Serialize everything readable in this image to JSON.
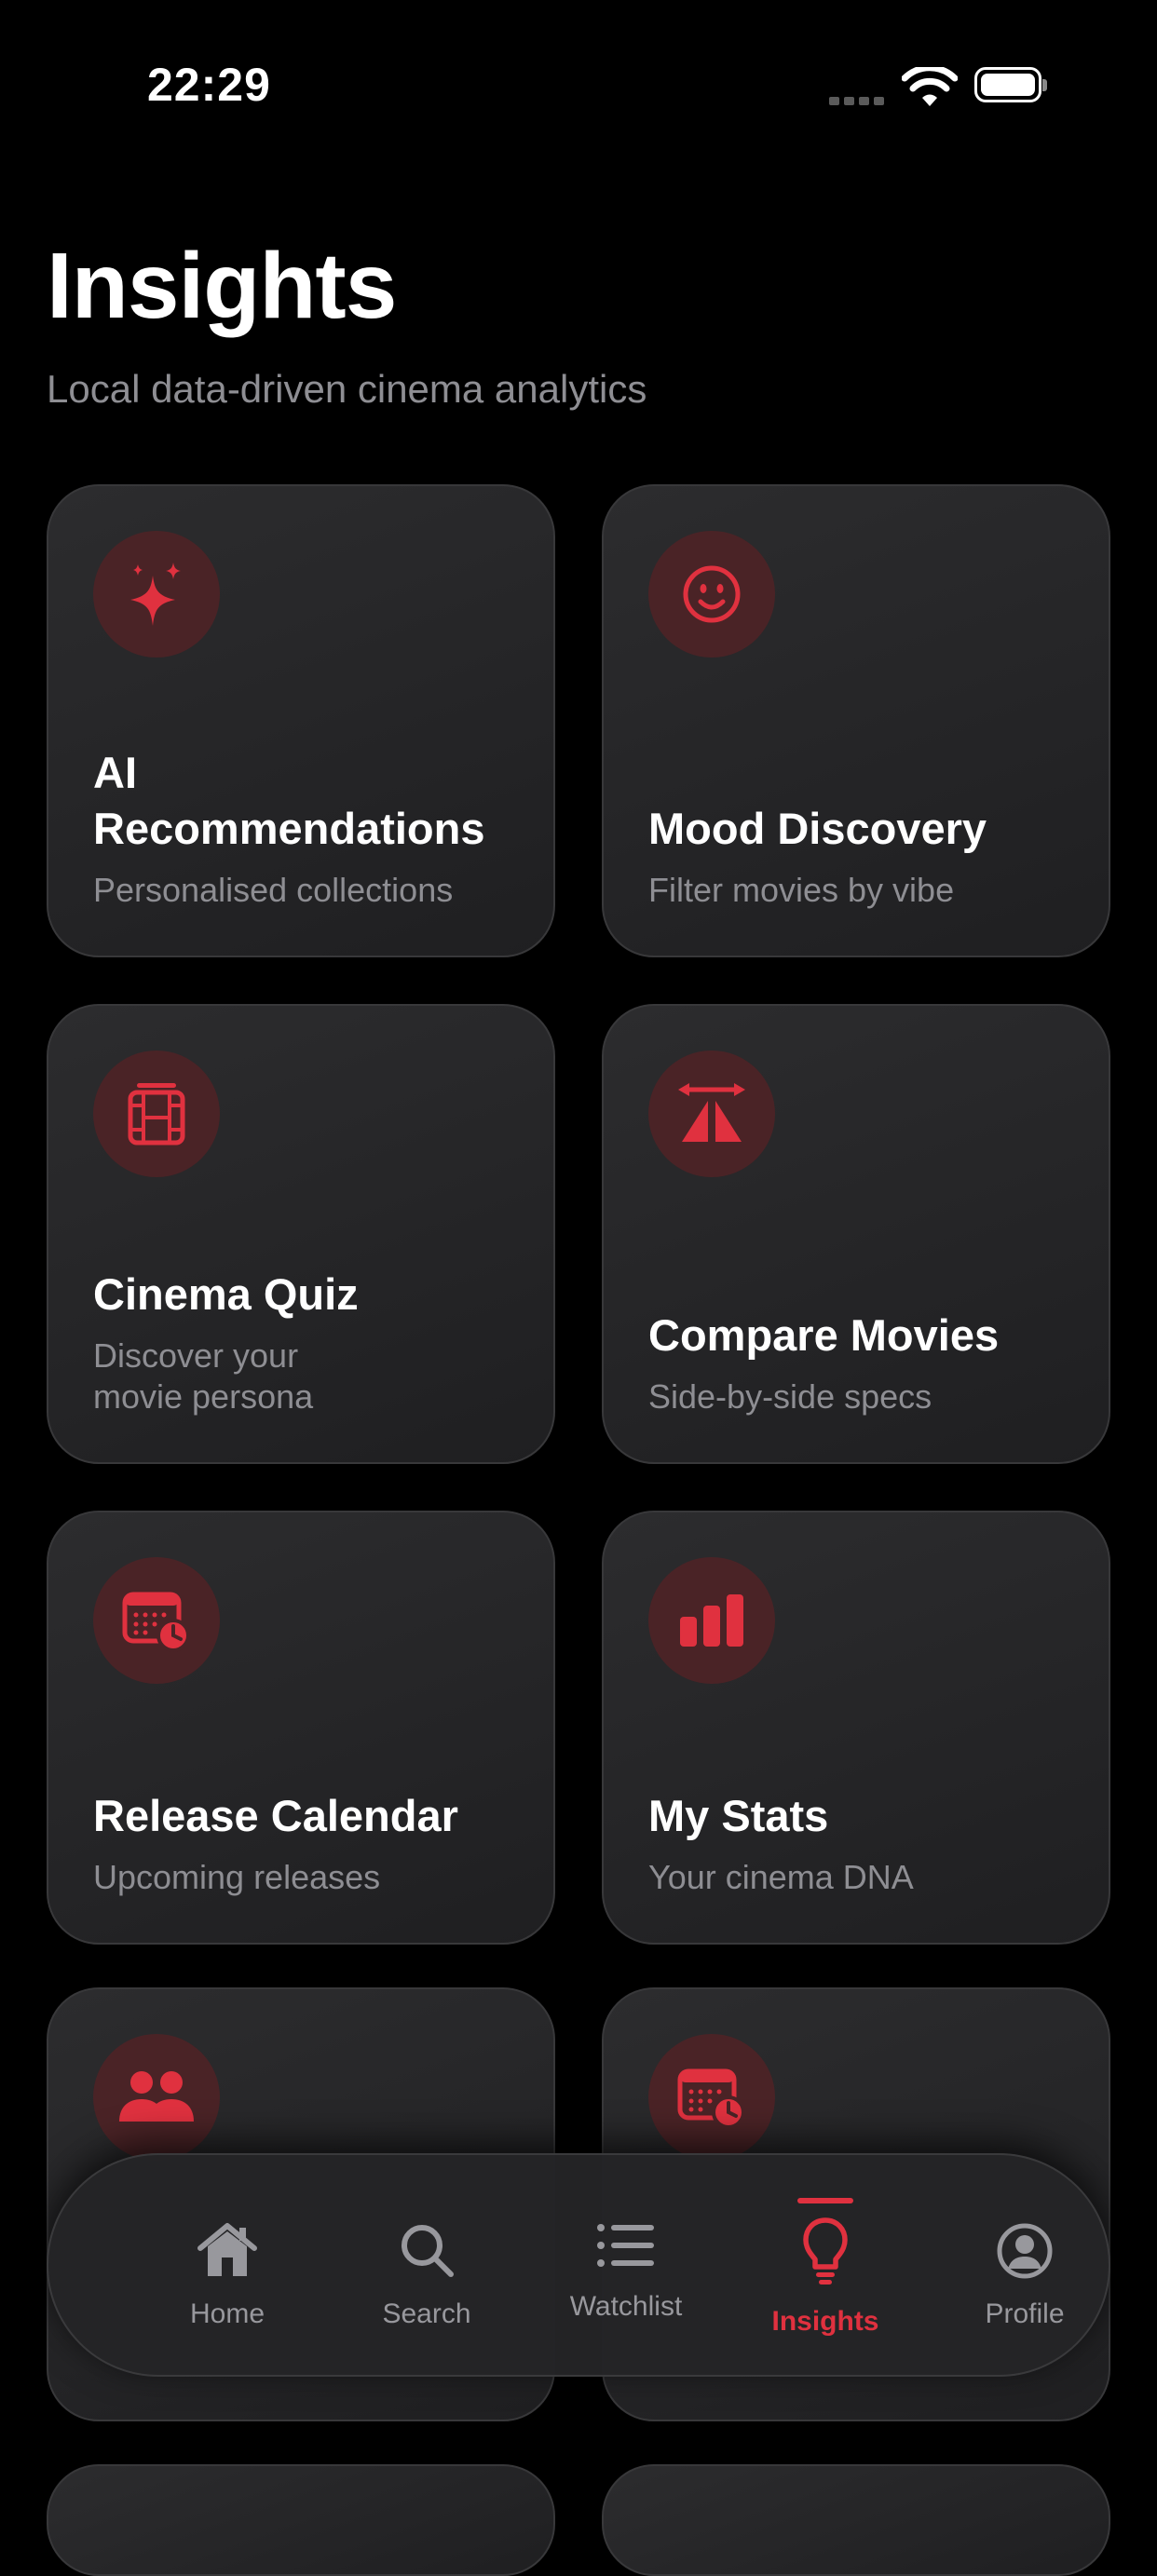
{
  "status_bar": {
    "time": "22:29"
  },
  "header": {
    "title": "Insights",
    "subtitle": "Local data-driven cinema analytics"
  },
  "accent_color": "#e0313f",
  "cards": [
    {
      "title": "AI Recommendations",
      "subtitle": "Personalised collections",
      "icon": "sparkles-icon"
    },
    {
      "title": "Mood Discovery",
      "subtitle": "Filter movies by vibe",
      "icon": "smiley-face-icon"
    },
    {
      "title": "Cinema Quiz",
      "subtitle": "Discover your movie persona",
      "icon": "film-strip-icon"
    },
    {
      "title": "Compare Movies",
      "subtitle": "Side-by-side specs",
      "icon": "compare-arrows-icon"
    },
    {
      "title": "Release Calendar",
      "subtitle": "Upcoming releases",
      "icon": "calendar-clock-icon"
    },
    {
      "title": "My Stats",
      "subtitle": "Your cinema DNA",
      "icon": "bar-chart-icon"
    },
    {
      "title": "",
      "subtitle": "",
      "icon": "people-icon"
    },
    {
      "title": "",
      "subtitle": "",
      "icon": "calendar-clock-icon"
    }
  ],
  "tab_bar": {
    "active": "Insights",
    "tabs": [
      {
        "label": "Home",
        "icon": "house-icon"
      },
      {
        "label": "Search",
        "icon": "magnifier-icon"
      },
      {
        "label": "Watchlist",
        "icon": "list-icon"
      },
      {
        "label": "Insights",
        "icon": "lightbulb-icon"
      },
      {
        "label": "Profile",
        "icon": "person-circle-icon"
      }
    ]
  }
}
